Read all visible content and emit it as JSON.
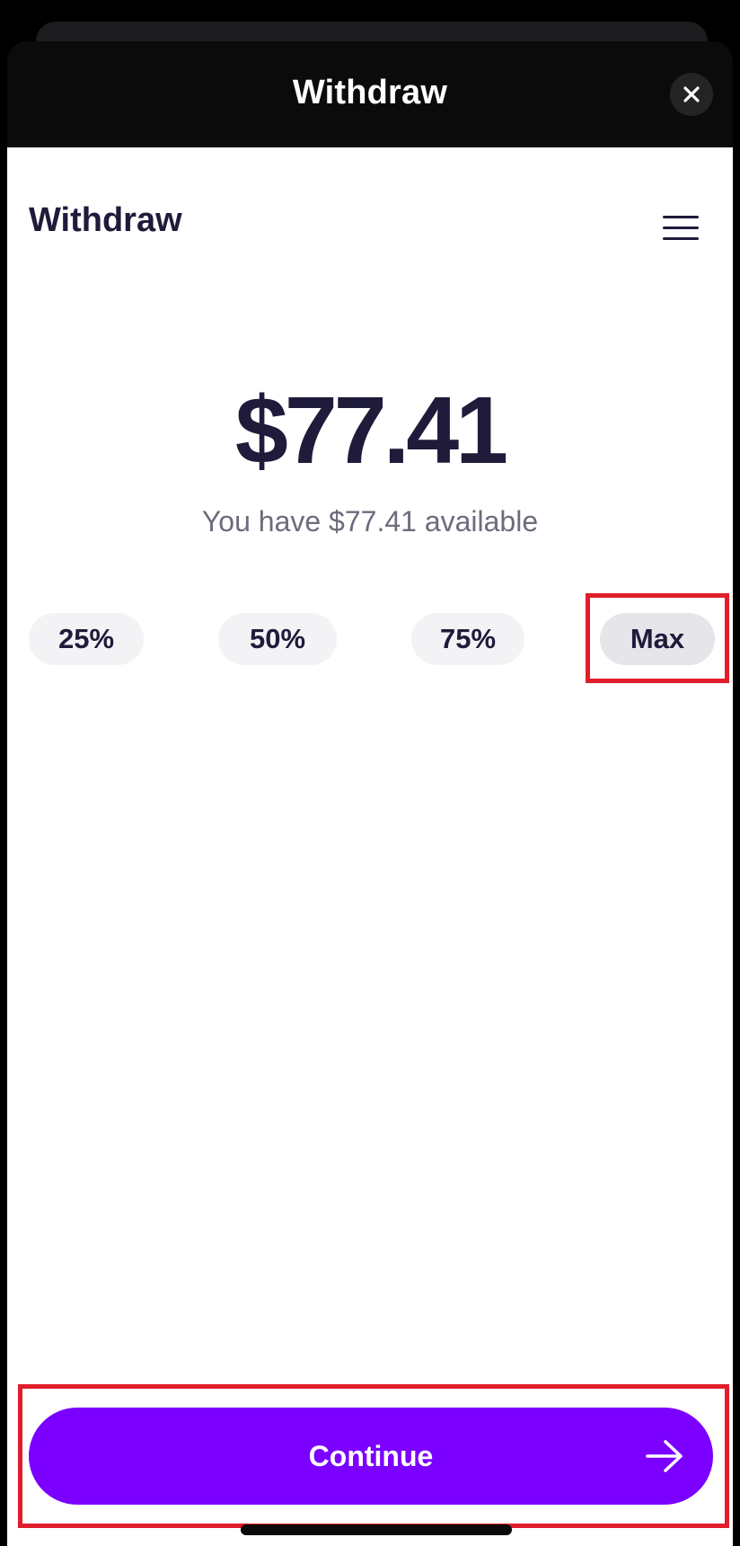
{
  "modal": {
    "title": "Withdraw",
    "close_icon": "close-icon"
  },
  "page": {
    "title": "Withdraw",
    "menu_icon": "hamburger-menu-icon"
  },
  "amount": {
    "value": "$77.41",
    "available_text": "You have $77.41 available"
  },
  "percent_options": [
    {
      "label": "25%"
    },
    {
      "label": "50%"
    },
    {
      "label": "75%"
    },
    {
      "label": "Max",
      "selected": true
    }
  ],
  "continue_button": {
    "label": "Continue",
    "icon": "arrow-right-icon"
  },
  "colors": {
    "accent": "#7b00ff",
    "text_primary": "#1f1b3a",
    "text_secondary": "#6e6b7c",
    "highlight": "#e01e2b",
    "header_background": "#0b0b0b"
  }
}
